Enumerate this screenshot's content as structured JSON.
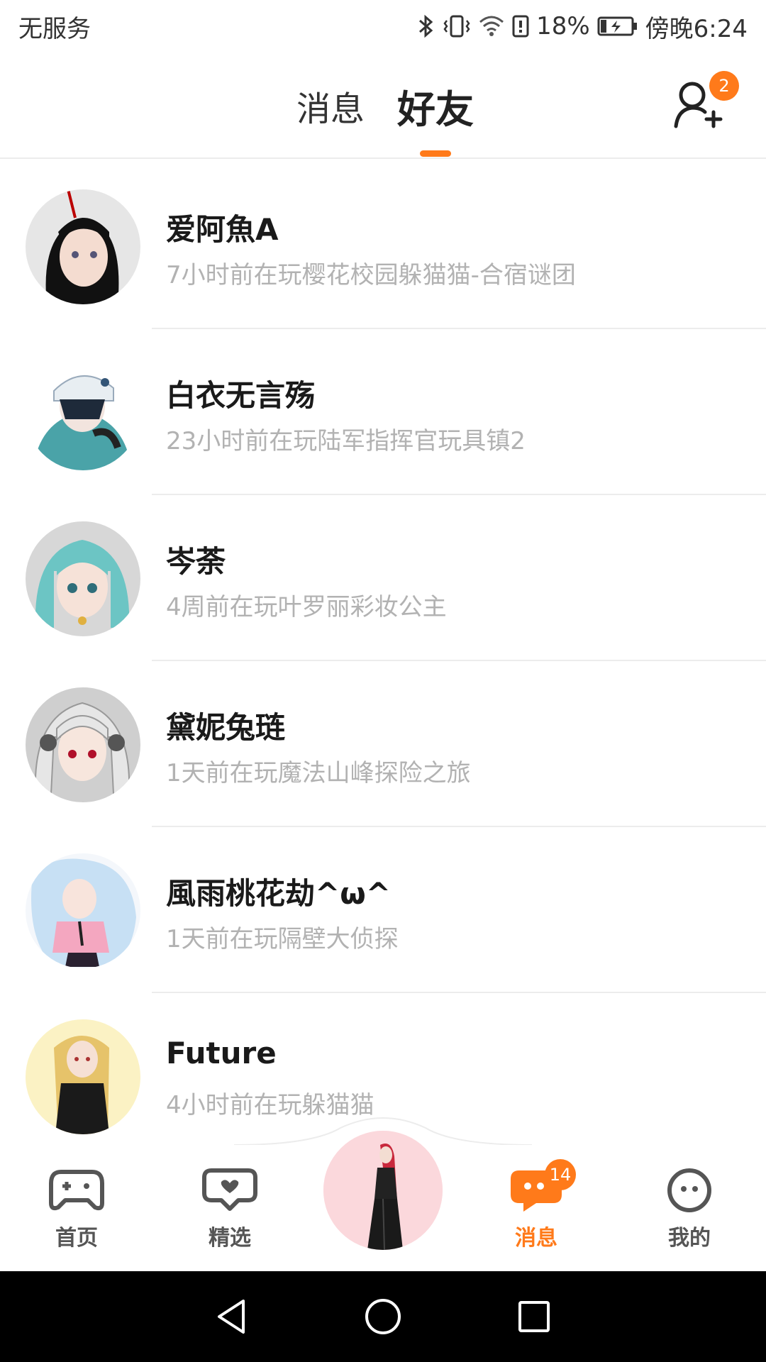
{
  "status_bar": {
    "carrier": "无服务",
    "battery_percent": "18%",
    "time": "傍晚6:24",
    "icons": [
      "bluetooth-icon",
      "vibrate-icon",
      "wifi-icon",
      "battery-alert-icon",
      "battery-charging-icon"
    ]
  },
  "header": {
    "tabs": [
      {
        "label": "消息",
        "active": false
      },
      {
        "label": "好友",
        "active": true
      }
    ],
    "add_friend_badge": "2",
    "accent_color": "#ff7a1a"
  },
  "friends": [
    {
      "name": "爱阿魚A",
      "status": "7小时前在玩樱花校园躲猫猫-合宿谜团"
    },
    {
      "name": "白衣无言殇",
      "status": "23小时前在玩陆军指挥官玩具镇2"
    },
    {
      "name": "岑荼",
      "status": "4周前在玩叶罗丽彩妆公主"
    },
    {
      "name": "黛妮兔琏",
      "status": "1天前在玩魔法山峰探险之旅"
    },
    {
      "name": "風雨桃花劫^ω^",
      "status": "1天前在玩隔壁大侦探"
    },
    {
      "name": "Future",
      "status": "4小时前在玩躲猫猫"
    }
  ],
  "tabbar": {
    "items": [
      {
        "label": "首页",
        "icon": "gamepad-icon",
        "active": false
      },
      {
        "label": "精选",
        "icon": "heart-chat-icon",
        "active": false
      },
      {
        "label": "消息",
        "icon": "message-icon",
        "active": true,
        "badge": "14"
      },
      {
        "label": "我的",
        "icon": "profile-face-icon",
        "active": false
      }
    ]
  },
  "system_nav": [
    "back-icon",
    "home-icon",
    "recents-icon"
  ]
}
